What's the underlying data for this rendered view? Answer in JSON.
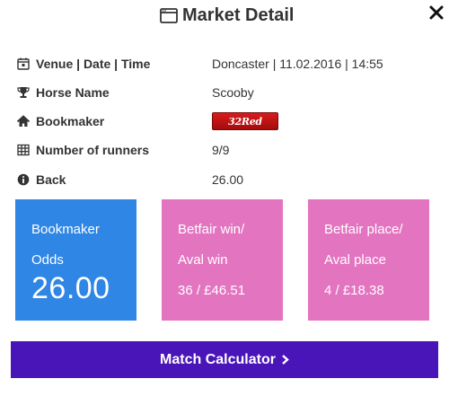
{
  "modal": {
    "title": "Market Detail",
    "icons": {
      "title": "window-icon",
      "close": "close-icon"
    }
  },
  "details": {
    "venue": {
      "label": "Venue | Date | Time",
      "value": "Doncaster | 11.02.2016 | 14:55",
      "icon": "calendar-icon"
    },
    "horse": {
      "label": "Horse Name",
      "value": "Scooby",
      "icon": "trophy-icon"
    },
    "bookmaker": {
      "label": "Bookmaker",
      "logo_text": "32Red",
      "icon": "home-icon"
    },
    "runners": {
      "label": "Number of runners",
      "value": "9/9",
      "icon": "table-icon"
    },
    "back": {
      "label": "Back",
      "value": "26.00",
      "icon": "info-icon"
    }
  },
  "cards": {
    "bookmaker": {
      "line1": "Bookmaker",
      "line2": "Odds",
      "value": "26.00",
      "color": "#2f86e5"
    },
    "betfair_win": {
      "line1": "Betfair win/",
      "line2": "Aval win",
      "value": "36 / £46.51",
      "color": "#e374c0"
    },
    "betfair_place": {
      "line1": "Betfair place/",
      "line2": "Aval place",
      "value": "4 / £18.38",
      "color": "#e374c0"
    }
  },
  "actions": {
    "calculator_label": "Match Calculator",
    "calculator_color": "#4a15b8"
  }
}
